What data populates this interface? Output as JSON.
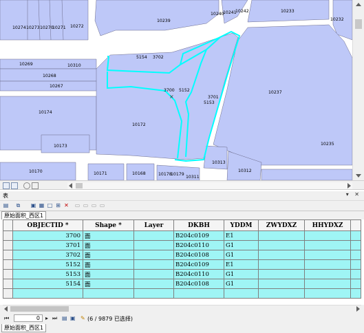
{
  "map": {
    "parcel_labels": [
      {
        "text": "10274"
      },
      {
        "text": "10273"
      },
      {
        "text": "10270"
      },
      {
        "text": "10271"
      },
      {
        "text": "10272"
      },
      {
        "text": "10239"
      },
      {
        "text": "10240"
      },
      {
        "text": "10241"
      },
      {
        "text": "10242"
      },
      {
        "text": "10233"
      },
      {
        "text": "10232"
      },
      {
        "text": "10269"
      },
      {
        "text": "10310"
      },
      {
        "text": "10268"
      },
      {
        "text": "10267"
      },
      {
        "text": "5154"
      },
      {
        "text": "3702"
      },
      {
        "text": "3700"
      },
      {
        "text": "5152"
      },
      {
        "text": "3701"
      },
      {
        "text": "5153"
      },
      {
        "text": "10237"
      },
      {
        "text": "10174"
      },
      {
        "text": "10172"
      },
      {
        "text": "10173"
      },
      {
        "text": "10235"
      },
      {
        "text": "10313"
      },
      {
        "text": "10312"
      },
      {
        "text": "10170"
      },
      {
        "text": "10171"
      },
      {
        "text": "10168"
      },
      {
        "text": "10178"
      },
      {
        "text": "10179"
      },
      {
        "text": "10311"
      }
    ],
    "selection_color": "#00ffff",
    "parcel_fill": "#bec8f8",
    "center_marker": "×"
  },
  "table_window": {
    "title": "表",
    "controls": "▾ ✕",
    "tab_label": "原始面积_西区1"
  },
  "table": {
    "columns": [
      "OBJECTID *",
      "Shape *",
      "Layer",
      "DKBH",
      "YDDM",
      "ZWYDXZ",
      "HHYDXZ"
    ],
    "rows": [
      {
        "marker": "",
        "cells": [
          "3700",
          "面",
          "",
          "B204c0109",
          "E1",
          "",
          ""
        ]
      },
      {
        "marker": "",
        "cells": [
          "3701",
          "面",
          "",
          "B204c0110",
          "G1",
          "",
          ""
        ]
      },
      {
        "marker": "",
        "cells": [
          "3702",
          "面",
          "",
          "B204c0108",
          "G1",
          "",
          ""
        ]
      },
      {
        "marker": "",
        "cells": [
          "5152",
          "面",
          "",
          "B204c0109",
          "E1",
          "",
          ""
        ]
      },
      {
        "marker": "",
        "cells": [
          "5153",
          "面",
          "",
          "B204c0110",
          "G1",
          "",
          ""
        ]
      },
      {
        "marker": "",
        "cells": [
          "5154",
          "面",
          "",
          "B204c0108",
          "G1",
          "",
          ""
        ]
      }
    ]
  },
  "nav": {
    "current_record": "0",
    "status": "(6 / 9879 已选择)"
  },
  "bottom_tab": {
    "label": "原始面积_西区1"
  }
}
